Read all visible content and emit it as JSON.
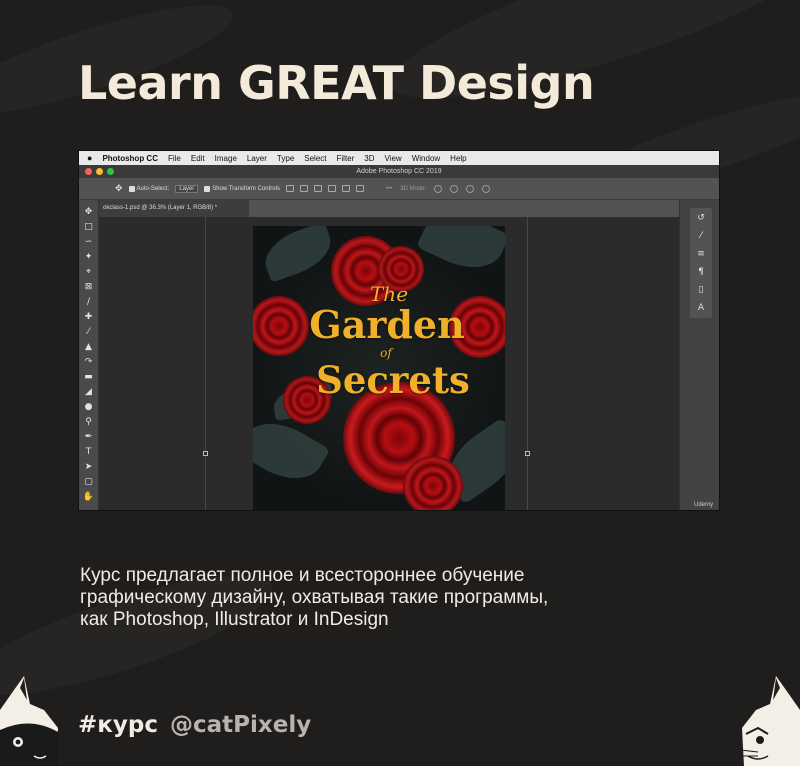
{
  "headline": "Learn GREAT Design",
  "screenshot": {
    "menubar": {
      "apple": "",
      "app_name": "Photoshop CC",
      "items": [
        "File",
        "Edit",
        "Image",
        "Layer",
        "Type",
        "Select",
        "Filter",
        "3D",
        "View",
        "Window",
        "Help"
      ]
    },
    "window_title": "Adobe Photoshop CC 2019",
    "options": {
      "auto_select": "Auto-Select:",
      "layer_select": "Layer",
      "show_transform": "Show Transform Controls",
      "mode_3d": "3D Mode:"
    },
    "doc_tab": "okclass-1.psd @ 36.3% (Layer 1, RGB/8) *",
    "poster": {
      "line1": "The",
      "line2": "Garden",
      "line3": "of",
      "line4": "Secrets"
    },
    "watermark": "Udemy"
  },
  "description": [
    "Курс предлагает полное и всестороннее обучение",
    "графическому дизайну, охватывая такие программы,",
    "как Photoshop, Illustrator и InDesign"
  ],
  "footer": {
    "hashtag": "#курс",
    "handle": "@catPixely"
  },
  "colors": {
    "background": "#1f1e1c",
    "text": "#f3ead9",
    "poster_gold": "#f0b029",
    "rose_red": "#c0161a"
  }
}
